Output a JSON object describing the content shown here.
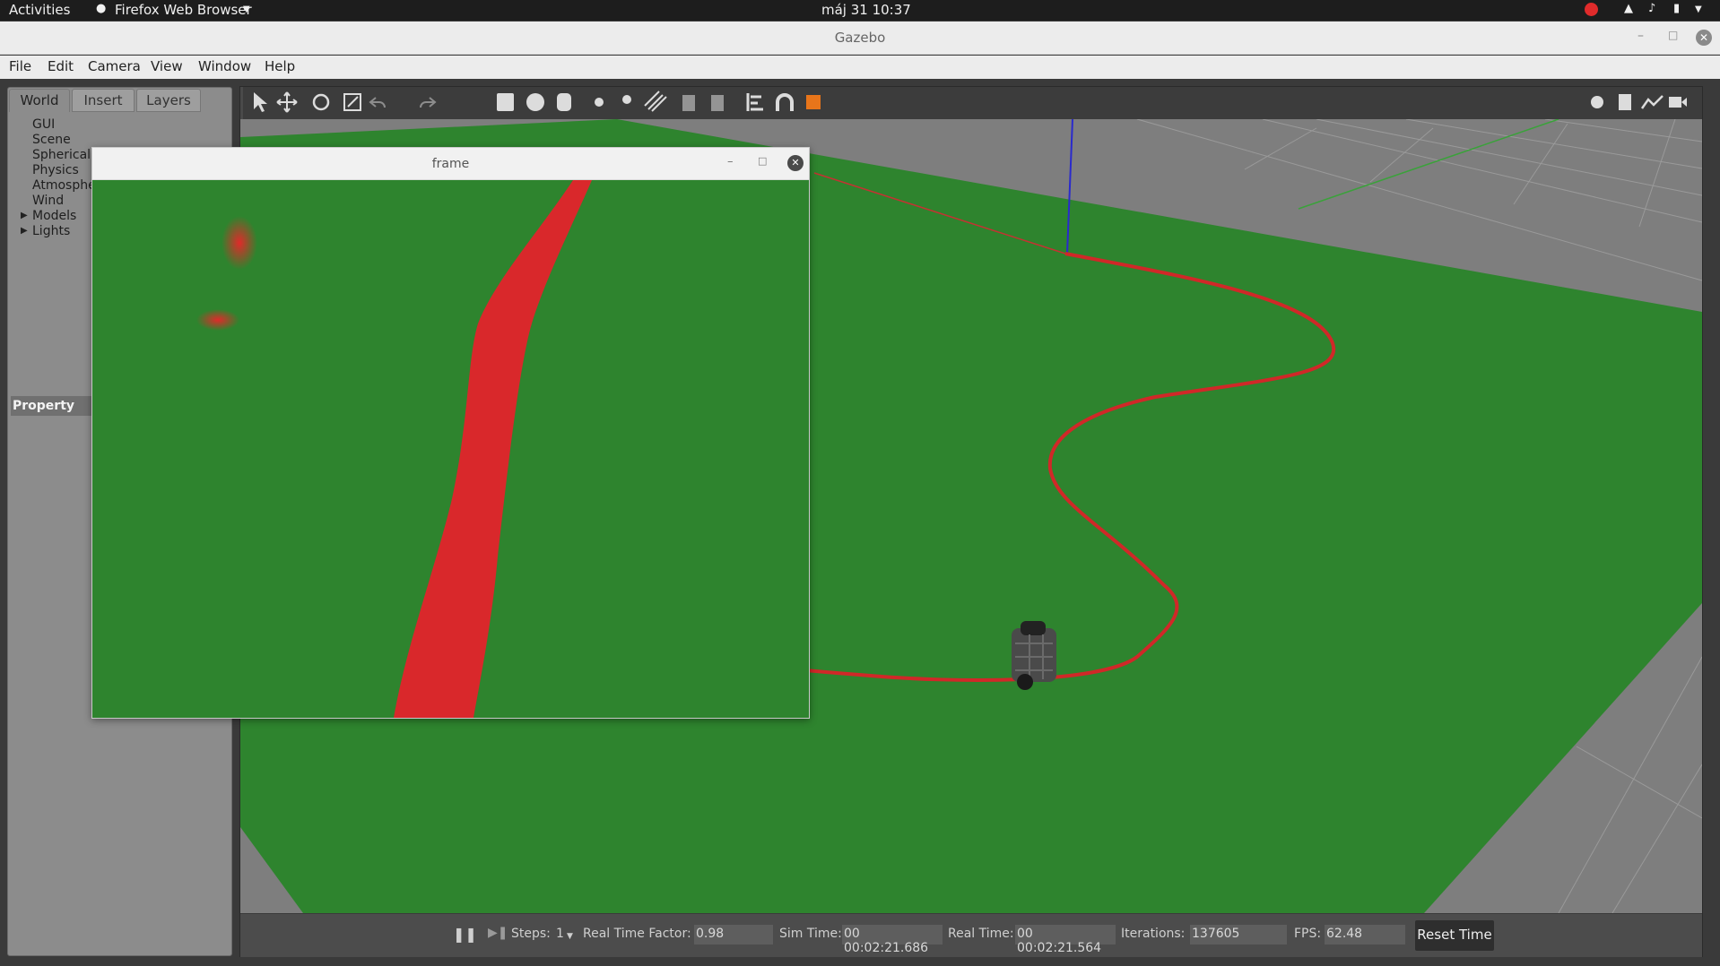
{
  "topbar": {
    "activities": "Activities",
    "app_name": "Firefox Web Browser",
    "datetime": "máj 31  10:37"
  },
  "window": {
    "title": "Gazebo"
  },
  "menu": [
    "File",
    "Edit",
    "Camera",
    "View",
    "Window",
    "Help"
  ],
  "left_panel": {
    "tabs": [
      "World",
      "Insert",
      "Layers"
    ],
    "tree": [
      "GUI",
      "Scene",
      "Spherical",
      "Physics",
      "Atmosphe",
      "Wind",
      "Models",
      "Lights"
    ],
    "property_label": "Property"
  },
  "frame_window": {
    "title": "frame"
  },
  "status": {
    "steps_label": "Steps:",
    "steps_value": "1",
    "rtf_label": "Real Time Factor:",
    "rtf_value": "0.98",
    "sim_time_label": "Sim Time:",
    "sim_time_value": "00 00:02:21.686",
    "real_time_label": "Real Time:",
    "real_time_value": "00 00:02:21.564",
    "iterations_label": "Iterations:",
    "iterations_value": "137605",
    "fps_label": "FPS:",
    "fps_value": "62.48",
    "reset_label": "Reset Time"
  },
  "colors": {
    "ground": "#2e842e",
    "line": "#e02a2a",
    "grid": "#9a9a9a"
  }
}
